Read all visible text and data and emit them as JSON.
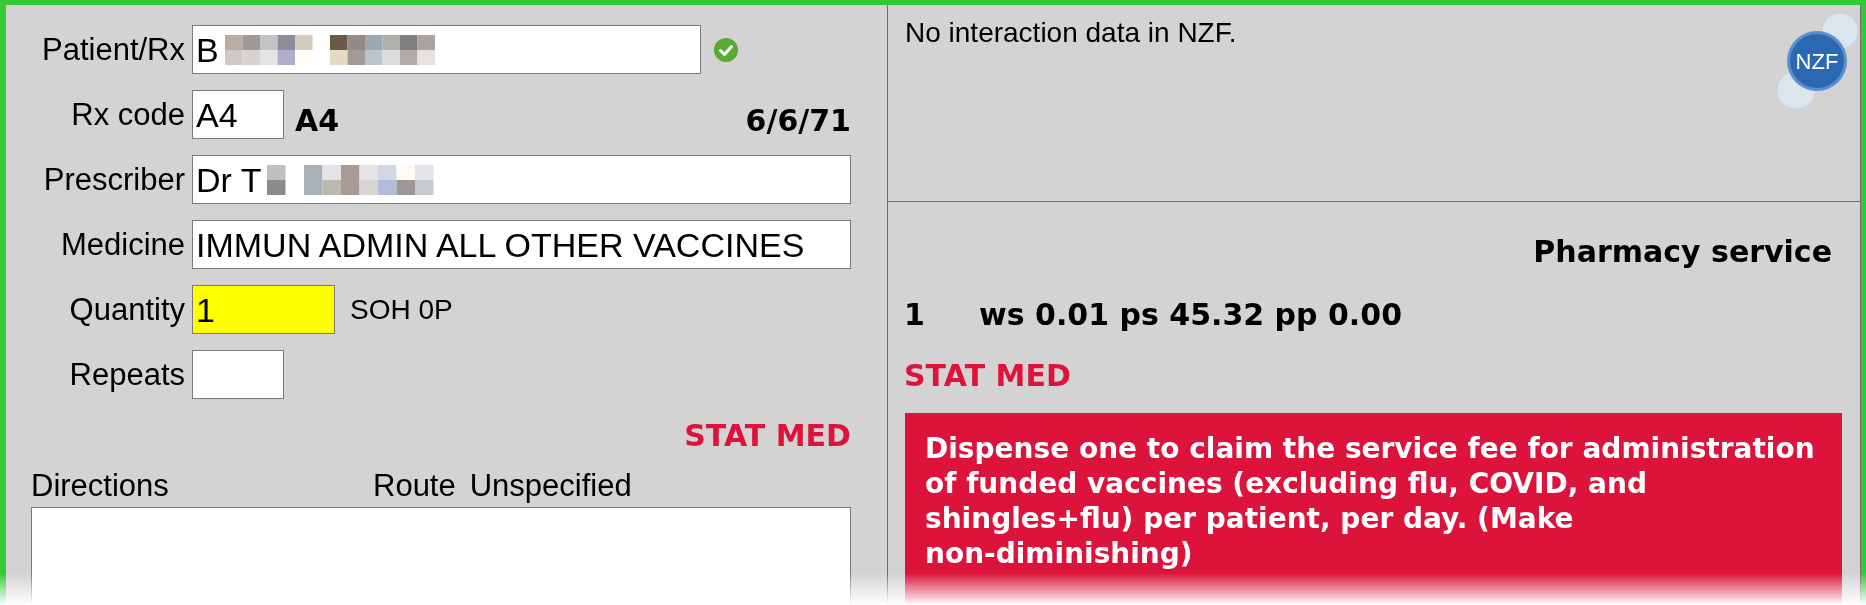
{
  "form": {
    "patient_rx": {
      "label": "Patient/Rx",
      "value": "B",
      "redacted": true,
      "verified": true
    },
    "rx_code": {
      "label": "Rx code",
      "value": "A4",
      "code_display": "A4",
      "date": "6/6/71"
    },
    "prescriber": {
      "label": "Prescriber",
      "value": "Dr T",
      "redacted": true
    },
    "medicine": {
      "label": "Medicine",
      "value": "IMMUN ADMIN ALL OTHER VACCINES"
    },
    "quantity": {
      "label": "Quantity",
      "value": "1",
      "highlighted": true,
      "stock": "SOH 0P"
    },
    "repeats": {
      "label": "Repeats"
    },
    "flag": "STAT MED",
    "directions": {
      "label": "Directions",
      "route_label": "Route",
      "route_value": "Unspecified"
    }
  },
  "interactions": {
    "message": "No interaction data in NZF.",
    "logo_text": "NZF"
  },
  "pricing": {
    "title": "Pharmacy service",
    "quantity": "1",
    "prices": "ws 0.01 ps 45.32 pp 0.00",
    "flag": "STAT MED",
    "notice": "Dispense one to claim the service fee for administration of funded vaccines (excluding flu, COVID, and shingles+flu) per patient, per day. (Make non-diminishing)"
  }
}
